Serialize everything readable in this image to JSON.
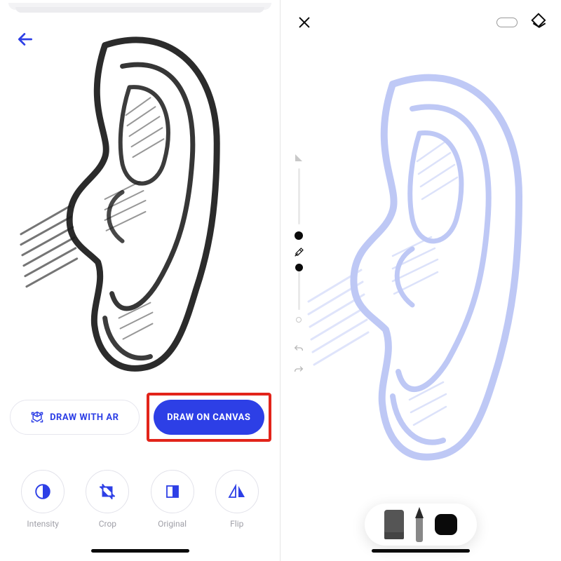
{
  "left": {
    "actions": {
      "draw_ar_label": "DRAW WITH AR",
      "draw_canvas_label": "DRAW ON CANVAS"
    },
    "tools": [
      {
        "name": "intensity",
        "label": "Intensity"
      },
      {
        "name": "crop",
        "label": "Crop"
      },
      {
        "name": "original",
        "label": "Original"
      },
      {
        "name": "flip",
        "label": "Flip"
      }
    ]
  },
  "right": {
    "icons": {
      "close": "close",
      "layers": "layers",
      "eyedropper": "eyedropper",
      "undo": "undo",
      "redo": "redo"
    }
  }
}
